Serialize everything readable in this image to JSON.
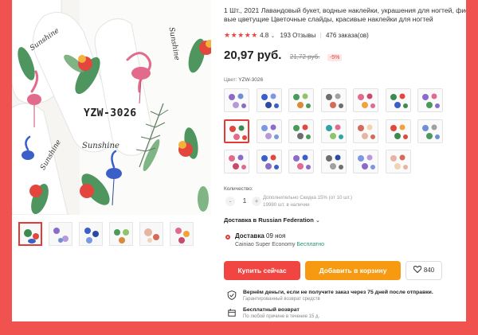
{
  "product": {
    "title_line1": "1 Шт., 2021 Лавандовый букет, водные наклейки, украшения для ногтей, фиол",
    "title_line2": "вые цветущие Цветочные слайды, красивые наклейки для ногтей",
    "stars": "★★★★★",
    "rating": "4.8",
    "reviews": "193 Отзывы",
    "orders": "476 заказа(ов)",
    "price": "20,97 руб.",
    "old_price": "21,72 руб.",
    "discount": "-5%",
    "image_text": {
      "code": "YZW-3026",
      "brand1": "Sunshine",
      "brand2": "Sunshine",
      "brand3": "Sunshine",
      "brand4": "Sunshine"
    }
  },
  "options": {
    "color_label": "Цвет:",
    "color_value": "YZW-3026",
    "selected_index": 7,
    "swatch_count": 20
  },
  "quantity": {
    "label": "Количество:",
    "value": "1",
    "minus": "-",
    "plus": "+",
    "note_line1": "Дополнительно Скидка 15% (от 10 шт.)",
    "note_line2": "19980 шт. в наличии"
  },
  "delivery": {
    "to_label": "Доставка в Russian Federation",
    "chevron": "⌄",
    "title": "Доставка",
    "date": "09 ноя",
    "carrier": "Cainiao Super Economy",
    "free": "Бесплатно"
  },
  "actions": {
    "buy_now": "Купить сейчас",
    "add_to_cart": "Добавить в корзину",
    "wishlist_count": "840"
  },
  "guarantee": {
    "refund_title": "Вернём деньги, если не получите заказ через 75 дней после отправки.",
    "refund_sub": "Гарантированный возврат средств",
    "return_title": "Бесплатный возврат",
    "return_sub": "По любой причине в течение 15 д."
  },
  "colors": {
    "accent": "#f04541",
    "cart": "#f79a12",
    "background": "#f0524f",
    "free_green": "#1a9a6b"
  }
}
